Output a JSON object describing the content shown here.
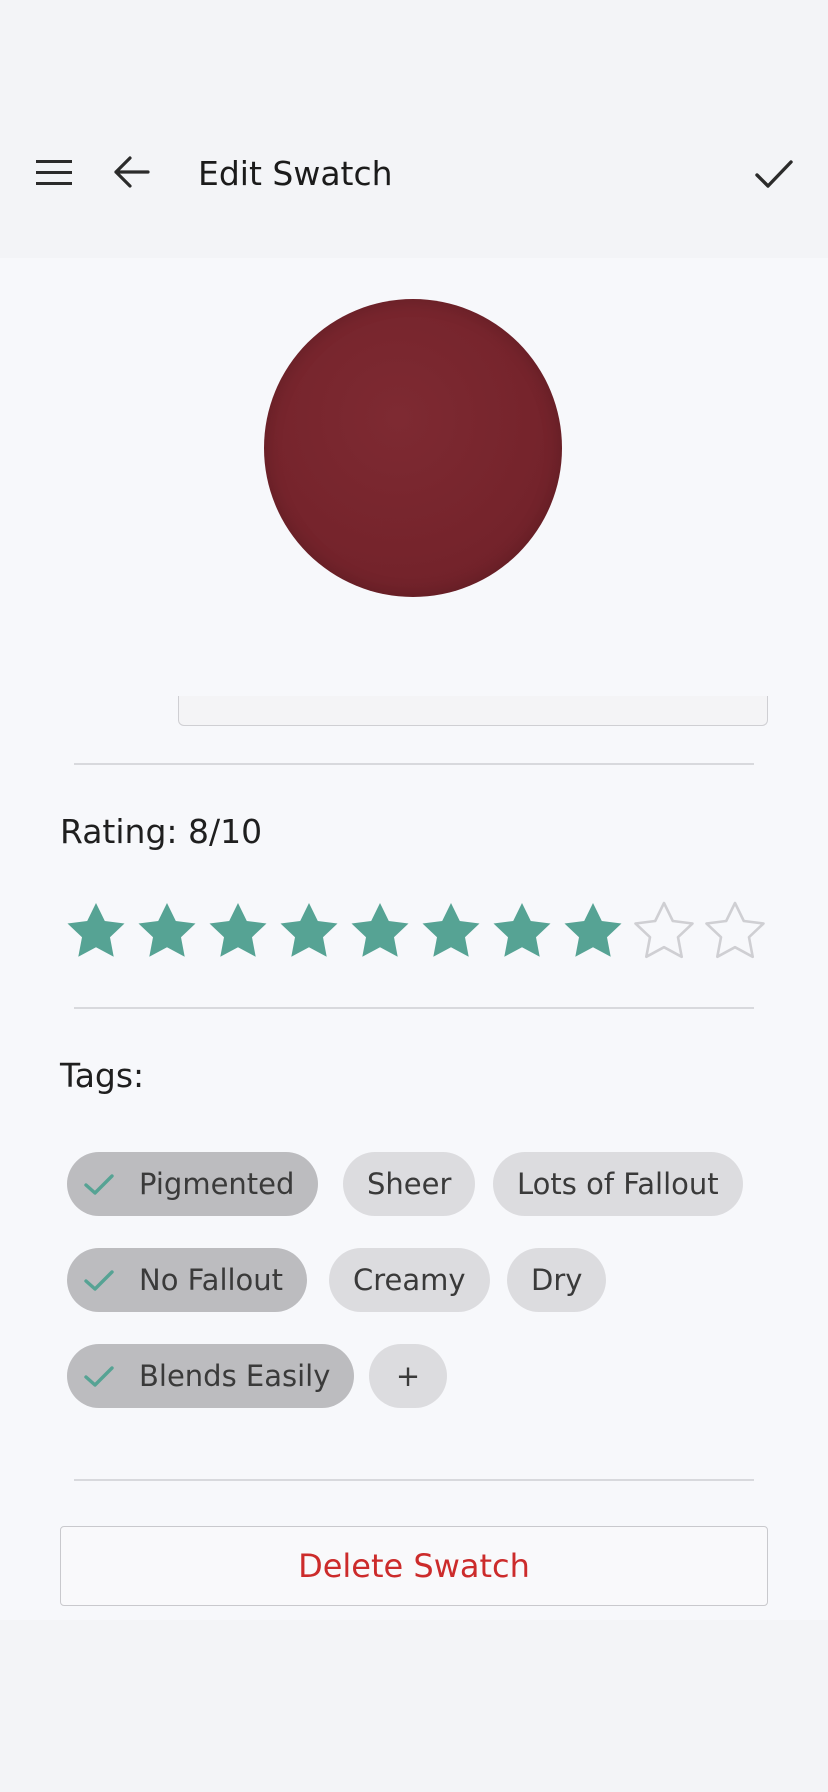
{
  "appbar": {
    "title": "Edit Swatch",
    "menu_icon": "hamburger-menu-icon",
    "back_icon": "arrow-left-icon",
    "done_icon": "checkmark-icon"
  },
  "swatch": {
    "color": "#76242c"
  },
  "rating": {
    "label": "Rating: 8/10",
    "value": 8,
    "max": 10,
    "filled_color": "#56a394",
    "empty_color": "#cfcfd3"
  },
  "tags": {
    "label": "Tags:",
    "items": [
      {
        "label": "Pigmented",
        "selected": true
      },
      {
        "label": "Sheer",
        "selected": false
      },
      {
        "label": "Lots of Fallout",
        "selected": false
      },
      {
        "label": "No Fallout",
        "selected": true
      },
      {
        "label": "Creamy",
        "selected": false
      },
      {
        "label": "Dry",
        "selected": false
      },
      {
        "label": "Blends Easily",
        "selected": true
      },
      {
        "label": "+",
        "selected": false
      }
    ],
    "check_color": "#56a394"
  },
  "actions": {
    "delete_label": "Delete Swatch",
    "delete_color": "#cc2b2b"
  }
}
